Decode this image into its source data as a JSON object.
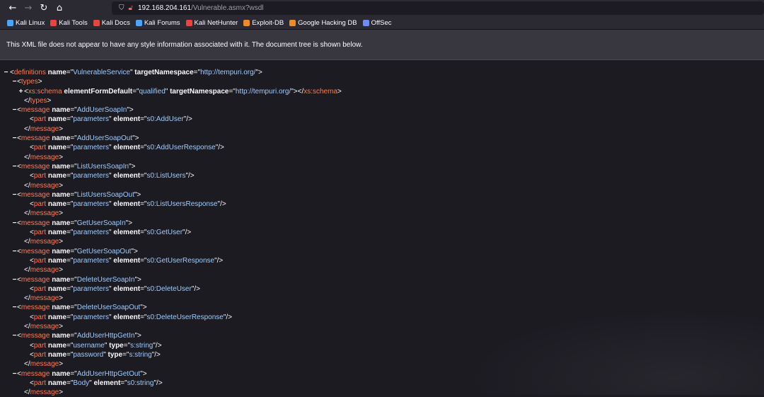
{
  "toolbar": {
    "url_host": "192.168.204.161",
    "url_path": "/Vulnerable.asmx?wsdl"
  },
  "bookmarks": [
    {
      "label": "Kali Linux",
      "color": "#4aa3ff"
    },
    {
      "label": "Kali Tools",
      "color": "#e3483a"
    },
    {
      "label": "Kali Docs",
      "color": "#e3483a"
    },
    {
      "label": "Kali Forums",
      "color": "#4aa3ff"
    },
    {
      "label": "Kali NetHunter",
      "color": "#e3483a"
    },
    {
      "label": "Exploit-DB",
      "color": "#f08a24"
    },
    {
      "label": "Google Hacking DB",
      "color": "#f08a24"
    },
    {
      "label": "OffSec",
      "color": "#6b8cff"
    }
  ],
  "info_message": "This XML file does not appear to have any style information associated with it. The document tree is shown below.",
  "xml_lines": [
    {
      "indent": 0,
      "toggle": "−",
      "parts": [
        [
          "p",
          "<"
        ],
        [
          "t",
          "definitions"
        ],
        [
          "p",
          " "
        ],
        [
          "an",
          "name"
        ],
        [
          "p",
          "=\""
        ],
        [
          "av",
          "VulnerableService"
        ],
        [
          "p",
          "\" "
        ],
        [
          "an",
          "targetNamespace"
        ],
        [
          "p",
          "=\""
        ],
        [
          "av",
          "http://tempuri.org/"
        ],
        [
          "p",
          "\">"
        ]
      ]
    },
    {
      "indent": 1,
      "toggle": "−",
      "parts": [
        [
          "p",
          "<"
        ],
        [
          "t",
          "types"
        ],
        [
          "p",
          ">"
        ]
      ]
    },
    {
      "indent": 2,
      "toggle": "+",
      "parts": [
        [
          "p",
          "<"
        ],
        [
          "t",
          "xs:schema"
        ],
        [
          "p",
          " "
        ],
        [
          "an",
          "elementFormDefault"
        ],
        [
          "p",
          "=\""
        ],
        [
          "av",
          "qualified"
        ],
        [
          "p",
          "\" "
        ],
        [
          "an",
          "targetNamespace"
        ],
        [
          "p",
          "=\""
        ],
        [
          "av",
          "http://tempuri.org/"
        ],
        [
          "p",
          "\">"
        ],
        [
          "p",
          "</"
        ],
        [
          "t",
          "xs:schema"
        ],
        [
          "p",
          ">"
        ]
      ]
    },
    {
      "indent": 2,
      "toggle": "",
      "parts": [
        [
          "p",
          "</"
        ],
        [
          "t",
          "types"
        ],
        [
          "p",
          ">"
        ]
      ]
    },
    {
      "indent": 1,
      "toggle": "−",
      "parts": [
        [
          "p",
          "<"
        ],
        [
          "t",
          "message"
        ],
        [
          "p",
          " "
        ],
        [
          "an",
          "name"
        ],
        [
          "p",
          "=\""
        ],
        [
          "av",
          "AddUserSoapIn"
        ],
        [
          "p",
          "\">"
        ]
      ]
    },
    {
      "indent": 3,
      "toggle": "",
      "parts": [
        [
          "p",
          "<"
        ],
        [
          "t",
          "part"
        ],
        [
          "p",
          " "
        ],
        [
          "an",
          "name"
        ],
        [
          "p",
          "=\""
        ],
        [
          "av",
          "parameters"
        ],
        [
          "p",
          "\" "
        ],
        [
          "an",
          "element"
        ],
        [
          "p",
          "=\""
        ],
        [
          "av",
          "s0:AddUser"
        ],
        [
          "p",
          "\"/>"
        ]
      ]
    },
    {
      "indent": 2,
      "toggle": "",
      "parts": [
        [
          "p",
          "</"
        ],
        [
          "t",
          "message"
        ],
        [
          "p",
          ">"
        ]
      ]
    },
    {
      "indent": 1,
      "toggle": "−",
      "parts": [
        [
          "p",
          "<"
        ],
        [
          "t",
          "message"
        ],
        [
          "p",
          " "
        ],
        [
          "an",
          "name"
        ],
        [
          "p",
          "=\""
        ],
        [
          "av",
          "AddUserSoapOut"
        ],
        [
          "p",
          "\">"
        ]
      ]
    },
    {
      "indent": 3,
      "toggle": "",
      "parts": [
        [
          "p",
          "<"
        ],
        [
          "t",
          "part"
        ],
        [
          "p",
          " "
        ],
        [
          "an",
          "name"
        ],
        [
          "p",
          "=\""
        ],
        [
          "av",
          "parameters"
        ],
        [
          "p",
          "\" "
        ],
        [
          "an",
          "element"
        ],
        [
          "p",
          "=\""
        ],
        [
          "av",
          "s0:AddUserResponse"
        ],
        [
          "p",
          "\"/>"
        ]
      ]
    },
    {
      "indent": 2,
      "toggle": "",
      "parts": [
        [
          "p",
          "</"
        ],
        [
          "t",
          "message"
        ],
        [
          "p",
          ">"
        ]
      ]
    },
    {
      "indent": 1,
      "toggle": "−",
      "parts": [
        [
          "p",
          "<"
        ],
        [
          "t",
          "message"
        ],
        [
          "p",
          " "
        ],
        [
          "an",
          "name"
        ],
        [
          "p",
          "=\""
        ],
        [
          "av",
          "ListUsersSoapIn"
        ],
        [
          "p",
          "\">"
        ]
      ]
    },
    {
      "indent": 3,
      "toggle": "",
      "parts": [
        [
          "p",
          "<"
        ],
        [
          "t",
          "part"
        ],
        [
          "p",
          " "
        ],
        [
          "an",
          "name"
        ],
        [
          "p",
          "=\""
        ],
        [
          "av",
          "parameters"
        ],
        [
          "p",
          "\" "
        ],
        [
          "an",
          "element"
        ],
        [
          "p",
          "=\""
        ],
        [
          "av",
          "s0:ListUsers"
        ],
        [
          "p",
          "\"/>"
        ]
      ]
    },
    {
      "indent": 2,
      "toggle": "",
      "parts": [
        [
          "p",
          "</"
        ],
        [
          "t",
          "message"
        ],
        [
          "p",
          ">"
        ]
      ]
    },
    {
      "indent": 1,
      "toggle": "−",
      "parts": [
        [
          "p",
          "<"
        ],
        [
          "t",
          "message"
        ],
        [
          "p",
          " "
        ],
        [
          "an",
          "name"
        ],
        [
          "p",
          "=\""
        ],
        [
          "av",
          "ListUsersSoapOut"
        ],
        [
          "p",
          "\">"
        ]
      ]
    },
    {
      "indent": 3,
      "toggle": "",
      "parts": [
        [
          "p",
          "<"
        ],
        [
          "t",
          "part"
        ],
        [
          "p",
          " "
        ],
        [
          "an",
          "name"
        ],
        [
          "p",
          "=\""
        ],
        [
          "av",
          "parameters"
        ],
        [
          "p",
          "\" "
        ],
        [
          "an",
          "element"
        ],
        [
          "p",
          "=\""
        ],
        [
          "av",
          "s0:ListUsersResponse"
        ],
        [
          "p",
          "\"/>"
        ]
      ]
    },
    {
      "indent": 2,
      "toggle": "",
      "parts": [
        [
          "p",
          "</"
        ],
        [
          "t",
          "message"
        ],
        [
          "p",
          ">"
        ]
      ]
    },
    {
      "indent": 1,
      "toggle": "−",
      "parts": [
        [
          "p",
          "<"
        ],
        [
          "t",
          "message"
        ],
        [
          "p",
          " "
        ],
        [
          "an",
          "name"
        ],
        [
          "p",
          "=\""
        ],
        [
          "av",
          "GetUserSoapIn"
        ],
        [
          "p",
          "\">"
        ]
      ]
    },
    {
      "indent": 3,
      "toggle": "",
      "parts": [
        [
          "p",
          "<"
        ],
        [
          "t",
          "part"
        ],
        [
          "p",
          " "
        ],
        [
          "an",
          "name"
        ],
        [
          "p",
          "=\""
        ],
        [
          "av",
          "parameters"
        ],
        [
          "p",
          "\" "
        ],
        [
          "an",
          "element"
        ],
        [
          "p",
          "=\""
        ],
        [
          "av",
          "s0:GetUser"
        ],
        [
          "p",
          "\"/>"
        ]
      ]
    },
    {
      "indent": 2,
      "toggle": "",
      "parts": [
        [
          "p",
          "</"
        ],
        [
          "t",
          "message"
        ],
        [
          "p",
          ">"
        ]
      ]
    },
    {
      "indent": 1,
      "toggle": "−",
      "parts": [
        [
          "p",
          "<"
        ],
        [
          "t",
          "message"
        ],
        [
          "p",
          " "
        ],
        [
          "an",
          "name"
        ],
        [
          "p",
          "=\""
        ],
        [
          "av",
          "GetUserSoapOut"
        ],
        [
          "p",
          "\">"
        ]
      ]
    },
    {
      "indent": 3,
      "toggle": "",
      "parts": [
        [
          "p",
          "<"
        ],
        [
          "t",
          "part"
        ],
        [
          "p",
          " "
        ],
        [
          "an",
          "name"
        ],
        [
          "p",
          "=\""
        ],
        [
          "av",
          "parameters"
        ],
        [
          "p",
          "\" "
        ],
        [
          "an",
          "element"
        ],
        [
          "p",
          "=\""
        ],
        [
          "av",
          "s0:GetUserResponse"
        ],
        [
          "p",
          "\"/>"
        ]
      ]
    },
    {
      "indent": 2,
      "toggle": "",
      "parts": [
        [
          "p",
          "</"
        ],
        [
          "t",
          "message"
        ],
        [
          "p",
          ">"
        ]
      ]
    },
    {
      "indent": 1,
      "toggle": "−",
      "parts": [
        [
          "p",
          "<"
        ],
        [
          "t",
          "message"
        ],
        [
          "p",
          " "
        ],
        [
          "an",
          "name"
        ],
        [
          "p",
          "=\""
        ],
        [
          "av",
          "DeleteUserSoapIn"
        ],
        [
          "p",
          "\">"
        ]
      ]
    },
    {
      "indent": 3,
      "toggle": "",
      "parts": [
        [
          "p",
          "<"
        ],
        [
          "t",
          "part"
        ],
        [
          "p",
          " "
        ],
        [
          "an",
          "name"
        ],
        [
          "p",
          "=\""
        ],
        [
          "av",
          "parameters"
        ],
        [
          "p",
          "\" "
        ],
        [
          "an",
          "element"
        ],
        [
          "p",
          "=\""
        ],
        [
          "av",
          "s0:DeleteUser"
        ],
        [
          "p",
          "\"/>"
        ]
      ]
    },
    {
      "indent": 2,
      "toggle": "",
      "parts": [
        [
          "p",
          "</"
        ],
        [
          "t",
          "message"
        ],
        [
          "p",
          ">"
        ]
      ]
    },
    {
      "indent": 1,
      "toggle": "−",
      "parts": [
        [
          "p",
          "<"
        ],
        [
          "t",
          "message"
        ],
        [
          "p",
          " "
        ],
        [
          "an",
          "name"
        ],
        [
          "p",
          "=\""
        ],
        [
          "av",
          "DeleteUserSoapOut"
        ],
        [
          "p",
          "\">"
        ]
      ]
    },
    {
      "indent": 3,
      "toggle": "",
      "parts": [
        [
          "p",
          "<"
        ],
        [
          "t",
          "part"
        ],
        [
          "p",
          " "
        ],
        [
          "an",
          "name"
        ],
        [
          "p",
          "=\""
        ],
        [
          "av",
          "parameters"
        ],
        [
          "p",
          "\" "
        ],
        [
          "an",
          "element"
        ],
        [
          "p",
          "=\""
        ],
        [
          "av",
          "s0:DeleteUserResponse"
        ],
        [
          "p",
          "\"/>"
        ]
      ]
    },
    {
      "indent": 2,
      "toggle": "",
      "parts": [
        [
          "p",
          "</"
        ],
        [
          "t",
          "message"
        ],
        [
          "p",
          ">"
        ]
      ]
    },
    {
      "indent": 1,
      "toggle": "−",
      "parts": [
        [
          "p",
          "<"
        ],
        [
          "t",
          "message"
        ],
        [
          "p",
          " "
        ],
        [
          "an",
          "name"
        ],
        [
          "p",
          "=\""
        ],
        [
          "av",
          "AddUserHttpGetIn"
        ],
        [
          "p",
          "\">"
        ]
      ]
    },
    {
      "indent": 3,
      "toggle": "",
      "parts": [
        [
          "p",
          "<"
        ],
        [
          "t",
          "part"
        ],
        [
          "p",
          " "
        ],
        [
          "an",
          "name"
        ],
        [
          "p",
          "=\""
        ],
        [
          "av",
          "username"
        ],
        [
          "p",
          "\" "
        ],
        [
          "an",
          "type"
        ],
        [
          "p",
          "=\""
        ],
        [
          "av",
          "s:string"
        ],
        [
          "p",
          "\"/>"
        ]
      ]
    },
    {
      "indent": 3,
      "toggle": "",
      "parts": [
        [
          "p",
          "<"
        ],
        [
          "t",
          "part"
        ],
        [
          "p",
          " "
        ],
        [
          "an",
          "name"
        ],
        [
          "p",
          "=\""
        ],
        [
          "av",
          "password"
        ],
        [
          "p",
          "\" "
        ],
        [
          "an",
          "type"
        ],
        [
          "p",
          "=\""
        ],
        [
          "av",
          "s:string"
        ],
        [
          "p",
          "\"/>"
        ]
      ]
    },
    {
      "indent": 2,
      "toggle": "",
      "parts": [
        [
          "p",
          "</"
        ],
        [
          "t",
          "message"
        ],
        [
          "p",
          ">"
        ]
      ]
    },
    {
      "indent": 1,
      "toggle": "−",
      "parts": [
        [
          "p",
          "<"
        ],
        [
          "t",
          "message"
        ],
        [
          "p",
          " "
        ],
        [
          "an",
          "name"
        ],
        [
          "p",
          "=\""
        ],
        [
          "av",
          "AddUserHttpGetOut"
        ],
        [
          "p",
          "\">"
        ]
      ]
    },
    {
      "indent": 3,
      "toggle": "",
      "parts": [
        [
          "p",
          "<"
        ],
        [
          "t",
          "part"
        ],
        [
          "p",
          " "
        ],
        [
          "an",
          "name"
        ],
        [
          "p",
          "=\""
        ],
        [
          "av",
          "Body"
        ],
        [
          "p",
          "\" "
        ],
        [
          "an",
          "element"
        ],
        [
          "p",
          "=\""
        ],
        [
          "av",
          "s0:string"
        ],
        [
          "p",
          "\"/>"
        ]
      ]
    },
    {
      "indent": 2,
      "toggle": "",
      "parts": [
        [
          "p",
          "</"
        ],
        [
          "t",
          "message"
        ],
        [
          "p",
          ">"
        ]
      ]
    }
  ]
}
